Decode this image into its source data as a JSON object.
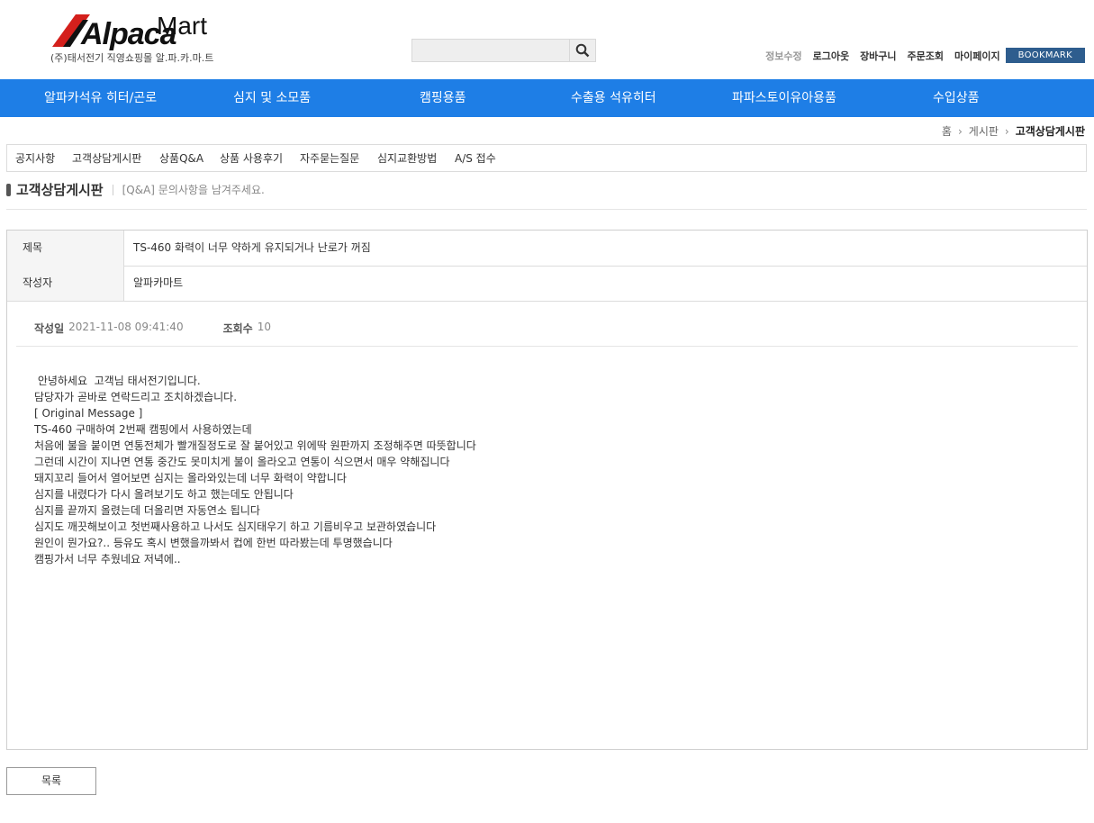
{
  "logo": {
    "text": "Alpaca",
    "mart": "Mart",
    "subtitle": "(주)태서전기 직영쇼핑몰 알.파.카.마.트"
  },
  "search": {
    "placeholder": "",
    "value": ""
  },
  "top_links": [
    "정보수정",
    "로그아웃",
    "장바구니",
    "주문조회",
    "마이페이지"
  ],
  "bookmark_label": "BOOKMARK",
  "nav": [
    "알파카석유 히터/곤로",
    "심지 및 소모품",
    "캠핑용품",
    "수출용 석유히터",
    "파파스토이유아용품",
    "수입상품"
  ],
  "breadcrumb": {
    "home": "홈",
    "board": "게시판",
    "current": "고객상담게시판"
  },
  "board_tabs": [
    "공지사항",
    "고객상담게시판",
    "상품Q&A",
    "상품 사용후기",
    "자주묻는질문",
    "심지교환방법",
    "A/S 접수"
  ],
  "board": {
    "title": "고객상담게시판",
    "description": "[Q&A] 문의사항을 남겨주세요."
  },
  "post": {
    "subject_label": "제목",
    "subject": "TS-460 화력이 너무 약하게 유지되거나 난로가 꺼짐",
    "author_label": "작성자",
    "author": "알파카마트",
    "date_label": "작성일",
    "date": "2021-11-08 09:41:40",
    "views_label": "조회수",
    "views": "10",
    "content": [
      " 안녕하세요  고객님 태서전기입니다.",
      "담당자가 곧바로 연락드리고 조치하겠습니다.",
      "",
      "",
      "[ Original Message ]",
      "TS-460 구매하여 2번째 캠핑에서 사용하였는데",
      "",
      "처음에 불을 붙이면 연통전체가 빨개질정도로 잘 붙어있고 위에딱 원판까지 조정해주면 따뜻합니다",
      "",
      "그런데 시간이 지나면 연통 중간도 못미치게 불이 올라오고 연통이 식으면서 매우 약해집니다",
      "",
      "돼지꼬리 들어서 열어보면 심지는 올라와있는데 너무 화력이 약합니다",
      "",
      "심지를 내렸다가 다시 올려보기도 하고 했는데도 안됩니다",
      "",
      "심지를 끝까지 올렸는데 더올리면 자동연소 됩니다",
      "",
      "심지도 깨끗해보이고 첫번째사용하고 나서도 심지태우기 하고 기름비우고 보관하였습니다",
      "",
      "원인이 뭔가요?.. 등유도 혹시 변했을까봐서 컵에 한번 따라봤는데 투명했습니다",
      "",
      "캠핑가서 너무 추웠네요 저녁에.."
    ]
  },
  "list_button": "목록",
  "colors": {
    "nav_bg": "#1e7ee6",
    "bookmark_bg": "#2e5d8e",
    "logo_red": "#d4201c"
  }
}
